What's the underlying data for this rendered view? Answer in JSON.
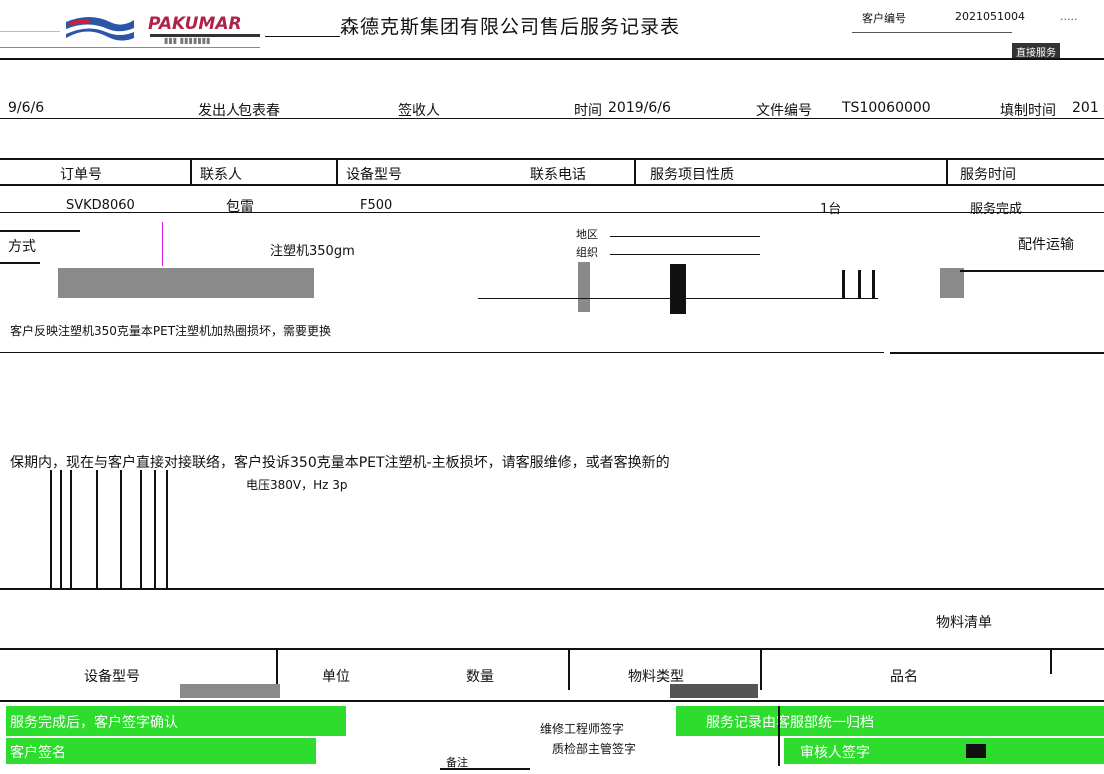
{
  "header": {
    "company": "PAKUMAR",
    "title": "森德克斯集团有限公司售后服务记录表",
    "customer_no_label": "客户编号",
    "customer_no": "2021051004",
    "badge": "直接服务"
  },
  "meta": {
    "date_left": "9/6/6",
    "sender_label": "发出人",
    "sender": "包表春",
    "receiver_label": "签收人",
    "time_label": "时间",
    "time": "2019/6/6",
    "file_label": "文件编号",
    "file_no": "TS10060000",
    "fill_label": "填制时间",
    "fill_value": "201"
  },
  "table_header": {
    "col1": "订单号",
    "col2": "联系人",
    "col3": "设备型号",
    "col4": "联系电话",
    "col5": "服务项目性质",
    "col6": "服务时间"
  },
  "row1": {
    "order": "SVKD8060",
    "contact": "包雷",
    "model": "F500",
    "phone": "",
    "qty": "1台",
    "status": "服务完成"
  },
  "address": {
    "method_label": "方式",
    "machine": "注塑机350gm",
    "region": "地区",
    "org": "组织",
    "right_label": "配件运输"
  },
  "problem_line": "客户反映注塑机350克量本PET注塑机加热圈损坏，需要更换",
  "description": "保期内，现在与客户直接对接联络，客户投诉350克量本PET注塑机-主板损坏，请客服维修，或者客换新的",
  "power": "电压380V，Hz 3p",
  "materials_label": "物料清单",
  "parts_table": {
    "col1": "设备型号",
    "col2": "单位",
    "col3": "数量",
    "col4": "物料类型",
    "col5": "品名"
  },
  "footer": {
    "left1": "服务完成后，客户签字确认",
    "left2": "客户签名",
    "mid1": "维修工程师签字",
    "mid2": "质检部主管签字",
    "right1": "服务记录由客服部统一归档",
    "right2": "审核人签字",
    "bottom": "备注"
  },
  "colors": {
    "accent": "#2ddc2d",
    "magenta": "#d51bd5",
    "brand": "#b0224a"
  }
}
